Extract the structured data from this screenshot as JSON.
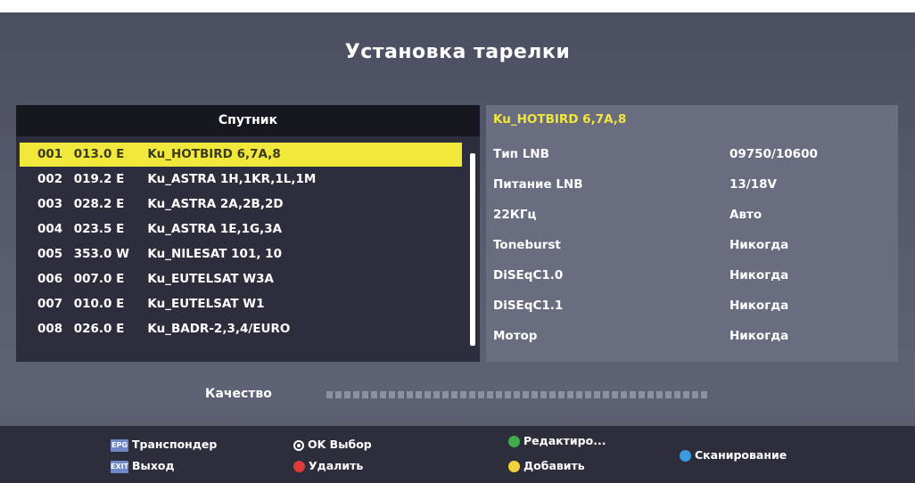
{
  "title": "Установка тарелки",
  "satellite_panel": {
    "header": "Спутник",
    "items": [
      {
        "num": "001",
        "pos": "013.0 E",
        "name": "Ku_HOTBIRD 6,7A,8",
        "selected": true
      },
      {
        "num": "002",
        "pos": "019.2 E",
        "name": "Ku_ASTRA 1H,1KR,1L,1M",
        "selected": false
      },
      {
        "num": "003",
        "pos": "028.2 E",
        "name": "Ku_ASTRA 2A,2B,2D",
        "selected": false
      },
      {
        "num": "004",
        "pos": "023.5 E",
        "name": "Ku_ASTRA 1E,1G,3A",
        "selected": false
      },
      {
        "num": "005",
        "pos": "353.0 W",
        "name": "Ku_NILESAT 101, 10",
        "selected": false
      },
      {
        "num": "006",
        "pos": "007.0 E",
        "name": "Ku_EUTELSAT W3A",
        "selected": false
      },
      {
        "num": "007",
        "pos": "010.0 E",
        "name": "Ku_EUTELSAT W1",
        "selected": false
      },
      {
        "num": "008",
        "pos": "026.0 E",
        "name": "Ku_BADR-2,3,4/EURO",
        "selected": false
      }
    ]
  },
  "details_panel": {
    "title": "Ku_HOTBIRD 6,7A,8",
    "params": [
      {
        "label": "Тип LNB",
        "value": "09750/10600"
      },
      {
        "label": "Питание LNB",
        "value": "13/18V"
      },
      {
        "label": "22КГц",
        "value": "Авто"
      },
      {
        "label": "Toneburst",
        "value": "Никогда"
      },
      {
        "label": "DiSEqC1.0",
        "value": "Никогда"
      },
      {
        "label": "DiSEqC1.1",
        "value": "Никогда"
      },
      {
        "label": "Мотор",
        "value": "Никогда"
      }
    ]
  },
  "quality": {
    "label": "Качество",
    "level": 0
  },
  "footer": {
    "epg_key": "EPG",
    "epg_label": "Транспондер",
    "exit_key": "EXIT",
    "exit_label": "Выход",
    "ok_label": "OK Выбор",
    "red_label": "Удалить",
    "green_label": "Редактиро...",
    "yellow_label": "Добавить",
    "blue_label": "Сканирование"
  },
  "colors": {
    "highlight": "#f2e83c",
    "red": "#e03a3a",
    "green": "#3fae4a",
    "yellow": "#f0d23a",
    "blue": "#3a9be0",
    "key_badge": "#6f86c8"
  }
}
